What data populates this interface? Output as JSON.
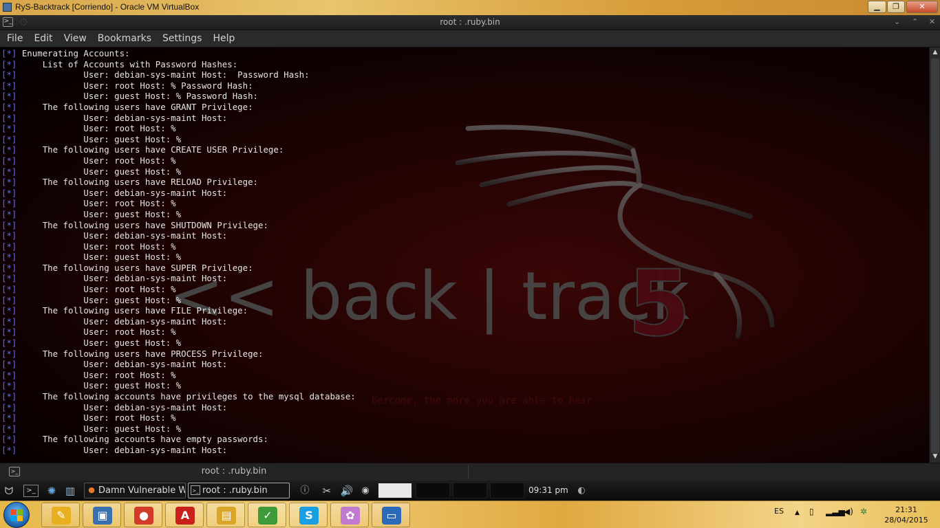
{
  "vbox_window": {
    "title": "RyS-Backtrack [Corriendo] - Oracle VM VirtualBox",
    "minimize": "▁",
    "maximize": "❐",
    "close": "✕"
  },
  "konsole": {
    "title": "root : .ruby.bin",
    "menu": [
      "File",
      "Edit",
      "View",
      "Bookmarks",
      "Settings",
      "Help"
    ],
    "tab_label": "root : .ruby.bin",
    "background_art": {
      "logo_text": "<< back | track",
      "logo_number": "5",
      "faint_tagline": "bercome, the more you are able to hear"
    },
    "lines": [
      "[*] Enumerating Accounts:",
      "[*]     List of Accounts with Password Hashes:",
      "[*]             User: debian-sys-maint Host:  Password Hash:",
      "[*]             User: root Host: % Password Hash:",
      "[*]             User: guest Host: % Password Hash:",
      "[*]     The following users have GRANT Privilege:",
      "[*]             User: debian-sys-maint Host:",
      "[*]             User: root Host: %",
      "[*]             User: guest Host: %",
      "[*]     The following users have CREATE USER Privilege:",
      "[*]             User: root Host: %",
      "[*]             User: guest Host: %",
      "[*]     The following users have RELOAD Privilege:",
      "[*]             User: debian-sys-maint Host:",
      "[*]             User: root Host: %",
      "[*]             User: guest Host: %",
      "[*]     The following users have SHUTDOWN Privilege:",
      "[*]             User: debian-sys-maint Host:",
      "[*]             User: root Host: %",
      "[*]             User: guest Host: %",
      "[*]     The following users have SUPER Privilege:",
      "[*]             User: debian-sys-maint Host:",
      "[*]             User: root Host: %",
      "[*]             User: guest Host: %",
      "[*]     The following users have FILE Privilege:",
      "[*]             User: debian-sys-maint Host:",
      "[*]             User: root Host: %",
      "[*]             User: guest Host: %",
      "[*]     The following users have PROCESS Privilege:",
      "[*]             User: debian-sys-maint Host:",
      "[*]             User: root Host: %",
      "[*]             User: guest Host: %",
      "[*]     The following accounts have privileges to the mysql database:",
      "[*]             User: debian-sys-maint Host:",
      "[*]             User: root Host: %",
      "[*]             User: guest Host: %",
      "[*]     The following accounts have empty passwords:",
      "[*]             User: debian-sys-maint Host:"
    ]
  },
  "kde_panel": {
    "tasks": [
      {
        "label": "Damn Vulnerable W",
        "icon": "firefox-icon"
      },
      {
        "label": "root : .ruby.bin",
        "icon": "terminal-icon"
      }
    ],
    "clock": "09:31 pm"
  },
  "windows_taskbar": {
    "language": "ES",
    "time": "21:31",
    "date": "28/04/2015",
    "pinned": [
      {
        "name": "file-manager-icon",
        "glyph": "✎"
      },
      {
        "name": "virtualbox-icon",
        "glyph": "▣"
      },
      {
        "name": "chrome-icon",
        "glyph": "●"
      },
      {
        "name": "pdf-reader-icon",
        "glyph": "A"
      },
      {
        "name": "folder-icon",
        "glyph": "▤"
      },
      {
        "name": "notepad-icon",
        "glyph": "✓"
      },
      {
        "name": "skype-icon",
        "glyph": "S"
      },
      {
        "name": "paint-icon",
        "glyph": "✿"
      },
      {
        "name": "remote-desktop-icon",
        "glyph": "▭"
      }
    ],
    "colors": {
      "file-manager-icon": "#e8b020",
      "virtualbox-icon": "#3a6fb0",
      "chrome-icon": "#d23a2a",
      "pdf-reader-icon": "#c8201a",
      "folder-icon": "#d9a52a",
      "notepad-icon": "#3f9a3a",
      "skype-icon": "#1aa0e0",
      "paint-icon": "#c07ad0",
      "remote-desktop-icon": "#2a6ab8"
    }
  }
}
